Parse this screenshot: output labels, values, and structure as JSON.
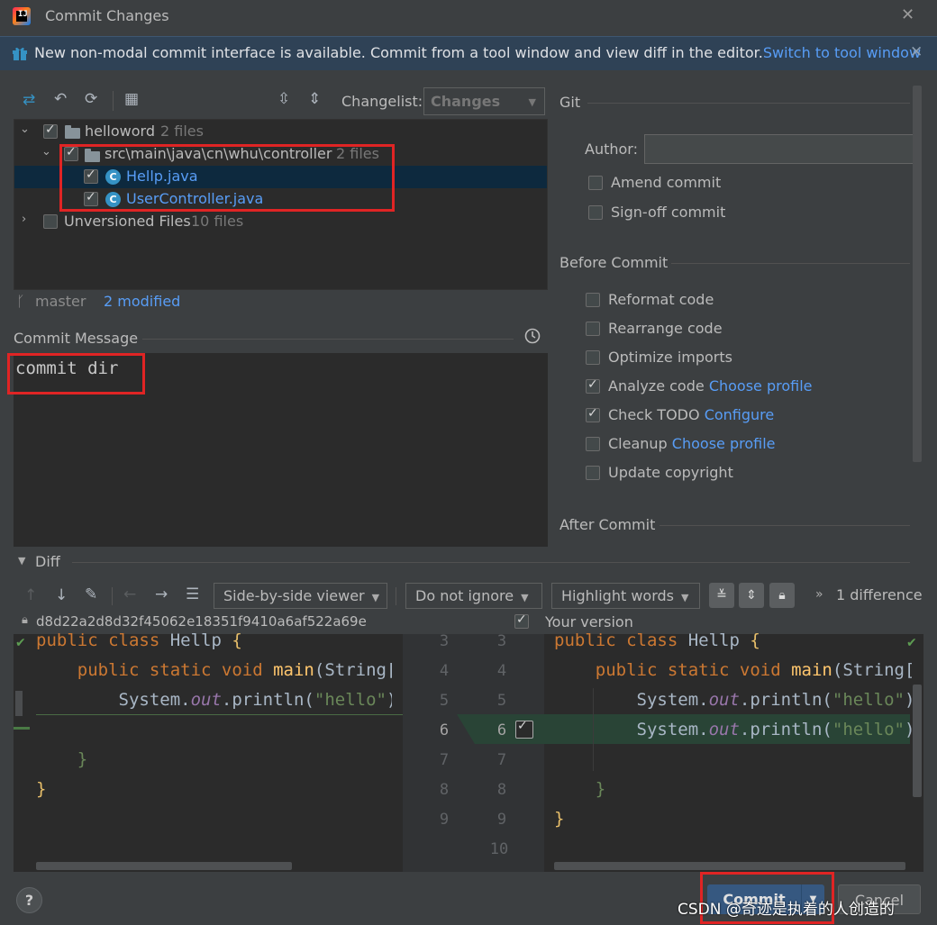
{
  "window": {
    "title": "Commit Changes",
    "close_symbol": "✕"
  },
  "banner": {
    "text": "New non-modal commit interface is available. Commit from a tool window and view diff in the editor.",
    "link": "Switch to tool window",
    "close_symbol": "✕"
  },
  "changelist": {
    "label": "Changelist:",
    "value": "Changes"
  },
  "tree": {
    "root": {
      "name": "helloword",
      "count": "2 files"
    },
    "folder": {
      "name": "src\\main\\java\\cn\\whu\\controller",
      "count": "2 files"
    },
    "files": [
      {
        "name": "Hellp.java"
      },
      {
        "name": "UserController.java"
      }
    ],
    "unversioned": {
      "name": "Unversioned Files",
      "count": "10 files"
    }
  },
  "branch": {
    "name": "master",
    "modified": "2 modified"
  },
  "commit_message": {
    "label": "Commit Message",
    "value": "commit dir"
  },
  "git": {
    "section": "Git",
    "author_label": "Author:",
    "author_value": "",
    "amend": "Amend commit",
    "signoff": "Sign-off commit"
  },
  "before_commit": {
    "section": "Before Commit",
    "reformat": "Reformat code",
    "rearrange": "Rearrange code",
    "optimize": "Optimize imports",
    "analyze": "Analyze code",
    "analyze_link": "Choose profile",
    "todo": "Check TODO",
    "todo_link": "Configure",
    "cleanup": "Cleanup",
    "cleanup_link": "Choose profile",
    "copyright": "Update copyright"
  },
  "after_commit": {
    "section": "After Commit"
  },
  "diff": {
    "section": "Diff",
    "viewer": "Side-by-side viewer",
    "ignore": "Do not ignore",
    "highlight": "Highlight words",
    "differences": "1 difference",
    "left_revision": "d8d22a2d8d32f45062e18351f9410a6af522a69e",
    "right_label": "Your version",
    "left_numbers": [
      "3",
      "4",
      "5",
      "6",
      "7",
      "8",
      "9"
    ],
    "right_numbers": [
      "3",
      "4",
      "5",
      "6",
      "7",
      "8",
      "9",
      "10"
    ]
  },
  "footer": {
    "help": "?",
    "commit": "Commit",
    "cancel": "Cancel",
    "watermark": "CSDN @奇迹是执着的人创造的"
  },
  "colors": {
    "accent": "#365880",
    "link": "#589df6",
    "highlight_box": "#e02424"
  }
}
